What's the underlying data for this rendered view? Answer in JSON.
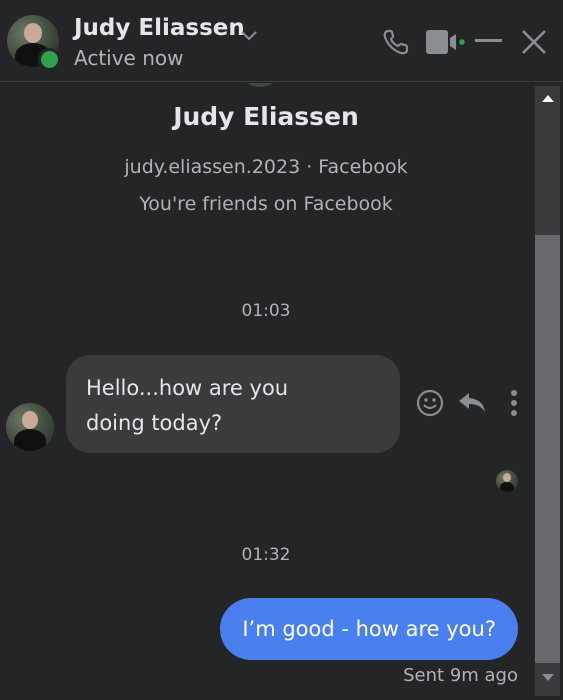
{
  "header": {
    "name": "Judy Eliassen",
    "status": "Active now",
    "icons": [
      "chevron-down-icon",
      "phone-icon",
      "video-icon",
      "minimize-icon",
      "close-icon"
    ],
    "online_color": "#31a24c"
  },
  "profile": {
    "name": "Judy Eliassen",
    "username_line": "judy.eliassen.2023 · Facebook",
    "friends_line": "You're friends on Facebook"
  },
  "messages": [
    {
      "timestamp": "01:03",
      "direction": "incoming",
      "text_line1": "Hello...how are you",
      "text_line2": "doing today?"
    },
    {
      "timestamp": "01:32",
      "direction": "outgoing",
      "text": "I’m good - how are you?",
      "status": "Sent 9m ago"
    }
  ],
  "message_actions": [
    "react-icon",
    "reply-icon",
    "more-icon"
  ],
  "colors": {
    "background": "#242526",
    "incoming_bubble": "#3a3b3c",
    "outgoing_bubble": "#4a7ff0"
  }
}
